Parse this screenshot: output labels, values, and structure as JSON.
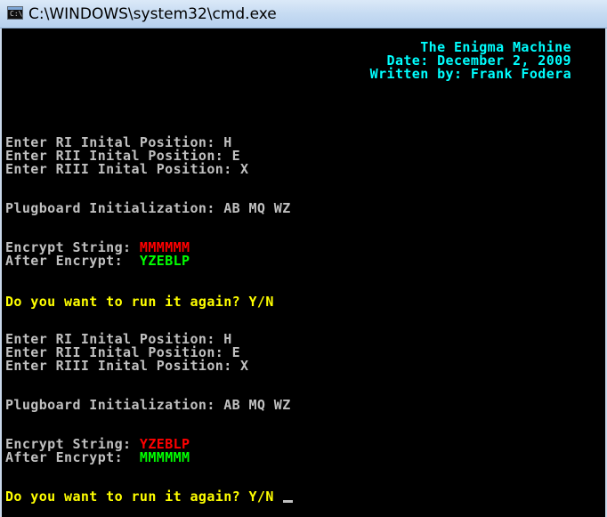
{
  "window": {
    "title": "C:\\WINDOWS\\system32\\cmd.exe",
    "icon": "cmd-icon",
    "icon_text": "C:\\"
  },
  "colors": {
    "background": "#000000",
    "text": "#c0c0c0",
    "header": "#00ffff",
    "prompt": "#ffff00",
    "input_string": "#ff0000",
    "output_string": "#00ff00"
  },
  "console": {
    "header": {
      "title": "The Enigma Machine",
      "date": "Date: December 2, 2009",
      "author": "Written by: Frank Fodera"
    },
    "run1": {
      "r1": "Enter RI Inital Position: H",
      "r2": "Enter RII Inital Position: E",
      "r3": "Enter RIII Inital Position: X",
      "plugboard": "Plugboard Initialization: AB MQ WZ",
      "encrypt_label": "Encrypt String: ",
      "encrypt_value": "MMMMMM",
      "after_label": "After Encrypt:  ",
      "after_value": "YZEBLP",
      "again_prompt": "Do you want to run it again? Y/N"
    },
    "run2": {
      "r1": "Enter RI Inital Position: H",
      "r2": "Enter RII Inital Position: E",
      "r3": "Enter RIII Inital Position: X",
      "plugboard": "Plugboard Initialization: AB MQ WZ",
      "encrypt_label": "Encrypt String: ",
      "encrypt_value": "YZEBLP",
      "after_label": "After Encrypt:  ",
      "after_value": "MMMMMM",
      "again_prompt": "Do you want to run it again? Y/N"
    }
  }
}
